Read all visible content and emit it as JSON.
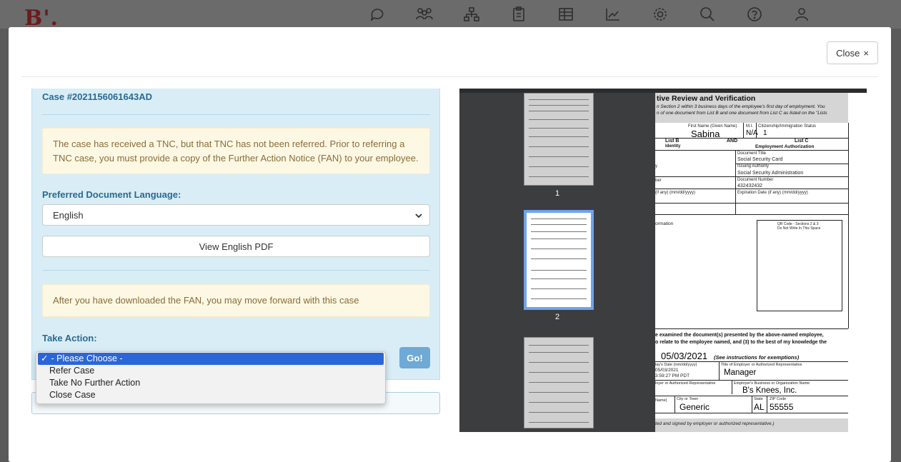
{
  "app": {
    "logo": "B'."
  },
  "appbar_icons": [
    "chat-icon",
    "users-icon",
    "org-chart-icon",
    "clipboard-icon",
    "table-icon",
    "chart-icon",
    "gear-icon",
    "search-icon",
    "help-icon",
    "user-icon"
  ],
  "modal": {
    "close_label": "Close",
    "close_glyph": "×"
  },
  "case": {
    "title": "Case #2021156061643AD",
    "tnc_notice": "The case has received a TNC, but that TNC has not been referred. Prior to referring a TNC case, you must provide a copy of the Further Action Notice (FAN) to your employee.",
    "language_label": "Preferred Document Language:",
    "language_value": "English",
    "view_pdf_label": "View English PDF",
    "fan_notice": "After you have downloaded the FAN, you may move forward with this case",
    "take_action_label": "Take Action:",
    "go_label": "Go!",
    "action_options": [
      "- Please Choose -",
      "Refer Case",
      "Take No Further Action",
      "Close Case"
    ],
    "action_selected_index": 0
  },
  "viewer": {
    "thumbnails": [
      {
        "label": "1",
        "active": false
      },
      {
        "label": "2",
        "active": true
      },
      {
        "label": "",
        "active": false
      }
    ],
    "page": {
      "header_title": "tive Review and Verification",
      "header_line1": "n Section 2 within 3 business days of the employee's first day of employment. You",
      "header_line2": "n of one document from List B and one document from List C as listed on the \"Lists",
      "first_name_label": "First Name (Given Name)",
      "first_name": "Sabina",
      "mi_label": "M.I.",
      "mi": "N/A",
      "citizenship_label": "Citizenship/Immigration Status",
      "citizenship": "1",
      "list_b": "List B",
      "identity": "Identity",
      "and": "AND",
      "list_c": "List C",
      "employment_auth": "Employment Authorization",
      "doc_title_label": "Document Title",
      "doc_title": "Social Security Card",
      "issuing_label": "Issuing Authority",
      "issuing": "Social Security Administration",
      "doc_number_label": "Document Number",
      "doc_number": "432432432",
      "exp_label_left": "(if any) (mm/dd/yyyy)",
      "exp_label_right": "Expiration Date (if any) (mm/dd/yyyy)",
      "frag_y": "y",
      "frag_ber": "ber",
      "additional_info": "ormation",
      "qr_line1": "QR Code - Sections 2 & 3",
      "qr_line2": "Do Not Write In This Space",
      "cert_line1": "e examined the document(s) presented by the above-named employee,",
      "cert_line2": "o relate to the employee named, and (3) to the best of my knowledge the",
      "first_day": "05/03/2021",
      "exemptions": "(See instructions for exemptions)",
      "today_label": "lay's Date (mm/dd/yyyy)",
      "today_date": "05/03/2021",
      "today_time": "3:59:27 PM PDT",
      "title_label": "Title of Employer or Authorized Representative",
      "title_value": "Manager",
      "employer_rep_label": "loyer or Authorized Representative",
      "business_label": "Employer's Business or Organization Name",
      "business_value": "B's Knees, Inc.",
      "name_frag": "Name)",
      "city_label": "City or Town",
      "city": "Generic",
      "state_label": "State",
      "state": "AL",
      "zip_label": "ZIP Code",
      "zip": "55555",
      "footer_note": "ted and signed by employer or authorized representative.)"
    }
  }
}
